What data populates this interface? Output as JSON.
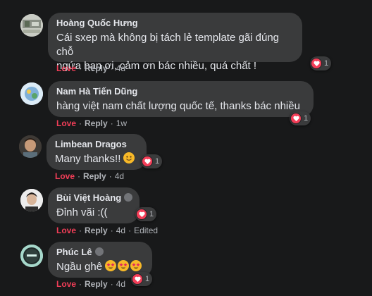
{
  "comments": [
    {
      "author": "Hoàng Quốc Hưng",
      "text_line1": "Cái sxep mà không bị tách lẻ template gãi đúng chỗ",
      "text_line2": "ngứa bạn ơi, cảm ơn bác nhiều, quá chất !",
      "love": "Love",
      "reply": "Reply",
      "time": "4d",
      "reaction_count": "1"
    },
    {
      "author": "Nam Hà Tiến Dũng",
      "text": "hàng việt nam chất lượng quốc tế, thanks bác nhiều",
      "love": "Love",
      "reply": "Reply",
      "time": "1w",
      "reaction_count": "1"
    },
    {
      "author": "Limbean Dragos",
      "text": "Many thanks!!",
      "love": "Love",
      "reply": "Reply",
      "time": "4d",
      "reaction_count": "1"
    },
    {
      "author": "Bùi Việt Hoàng",
      "text": "Đỉnh vãi :((",
      "love": "Love",
      "reply": "Reply",
      "time": "4d",
      "edited": "Edited",
      "reaction_count": "1"
    },
    {
      "author": "Phúc Lê",
      "text": "Ngầu ghê",
      "love": "Love",
      "reply": "Reply",
      "time": "4d",
      "reaction_count": "1"
    }
  ],
  "colors": {
    "background": "#18191a",
    "bubble": "#3a3b3c",
    "love": "#f33e58",
    "secondary_text": "#b0b3b8"
  },
  "icons": {
    "reaction": "heart-icon",
    "moderator_badge": "top-fan-badge-icon",
    "emoji_smile": "smile-emoji-icon",
    "emoji_star_eyes": "star-struck-emoji-icon"
  }
}
